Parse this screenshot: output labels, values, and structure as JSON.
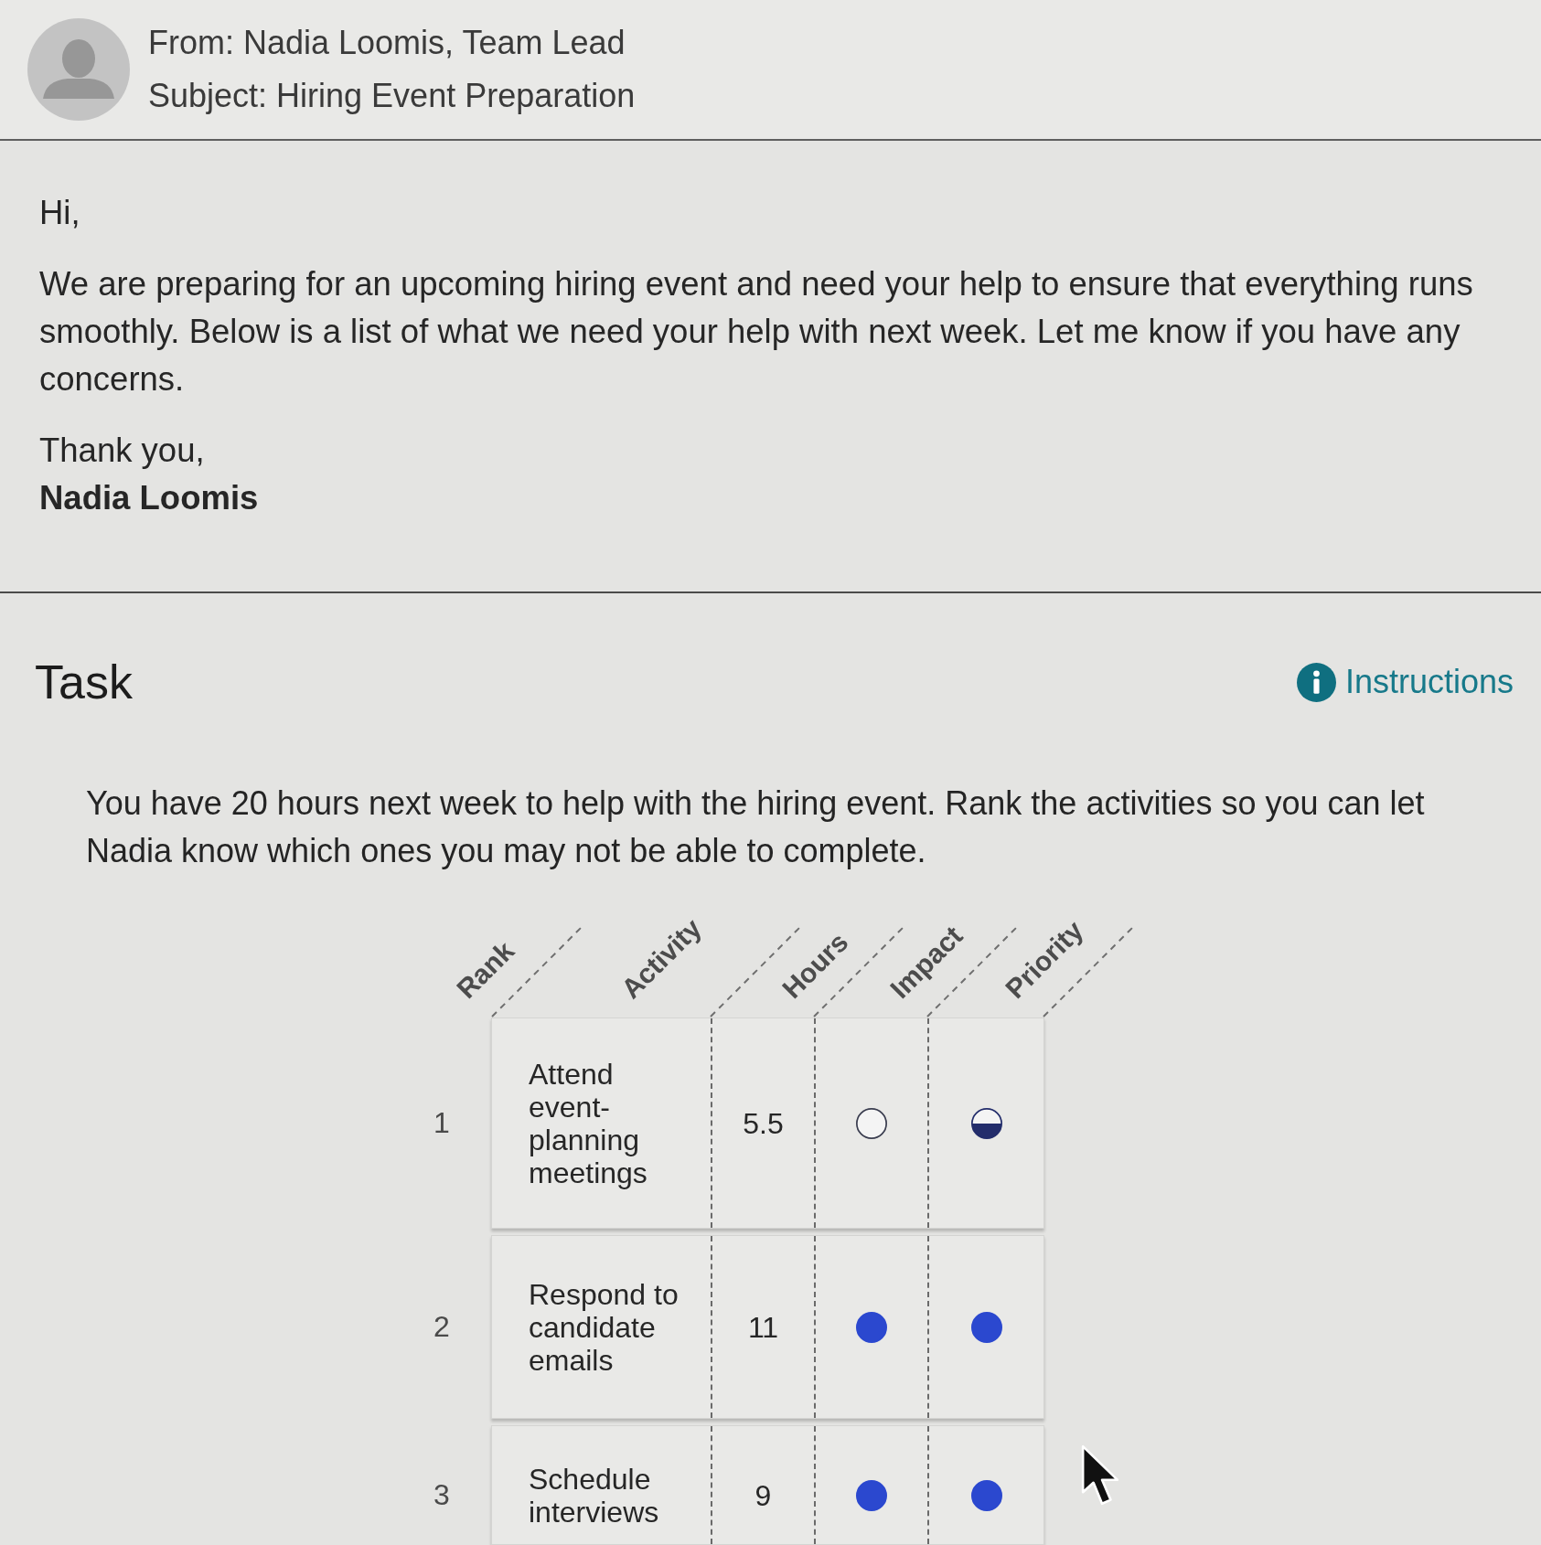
{
  "email": {
    "from": "From: Nadia Loomis, Team Lead",
    "subject": "Subject: Hiring Event Preparation",
    "greeting": "Hi,",
    "body": "We are preparing for an upcoming hiring event and need your help to ensure that everything runs smoothly. Below is a list of what we need your help with next week. Let me know if you have any concerns.",
    "closing": "Thank you,",
    "signature": "Nadia Loomis"
  },
  "task": {
    "title": "Task",
    "instructions_link": "Instructions",
    "prompt": "You have 20 hours next week to help with the hiring event. Rank the activities so you can let Nadia know which ones you may not be able to complete.",
    "table": {
      "columns": [
        "Rank",
        "Activity",
        "Hours",
        "Impact",
        "Priority"
      ],
      "rows": [
        {
          "rank": "1",
          "activity": "Attend event-planning meetings",
          "hours": "5.5",
          "impact": {
            "kind": "empty"
          },
          "priority": {
            "kind": "half"
          }
        },
        {
          "rank": "2",
          "activity": "Respond to candidate emails",
          "hours": "11",
          "impact": {
            "kind": "full"
          },
          "priority": {
            "kind": "full"
          }
        },
        {
          "rank": "3",
          "activity": "Schedule interviews",
          "hours": "9",
          "impact": {
            "kind": "full"
          },
          "priority": {
            "kind": "full"
          }
        }
      ]
    }
  }
}
